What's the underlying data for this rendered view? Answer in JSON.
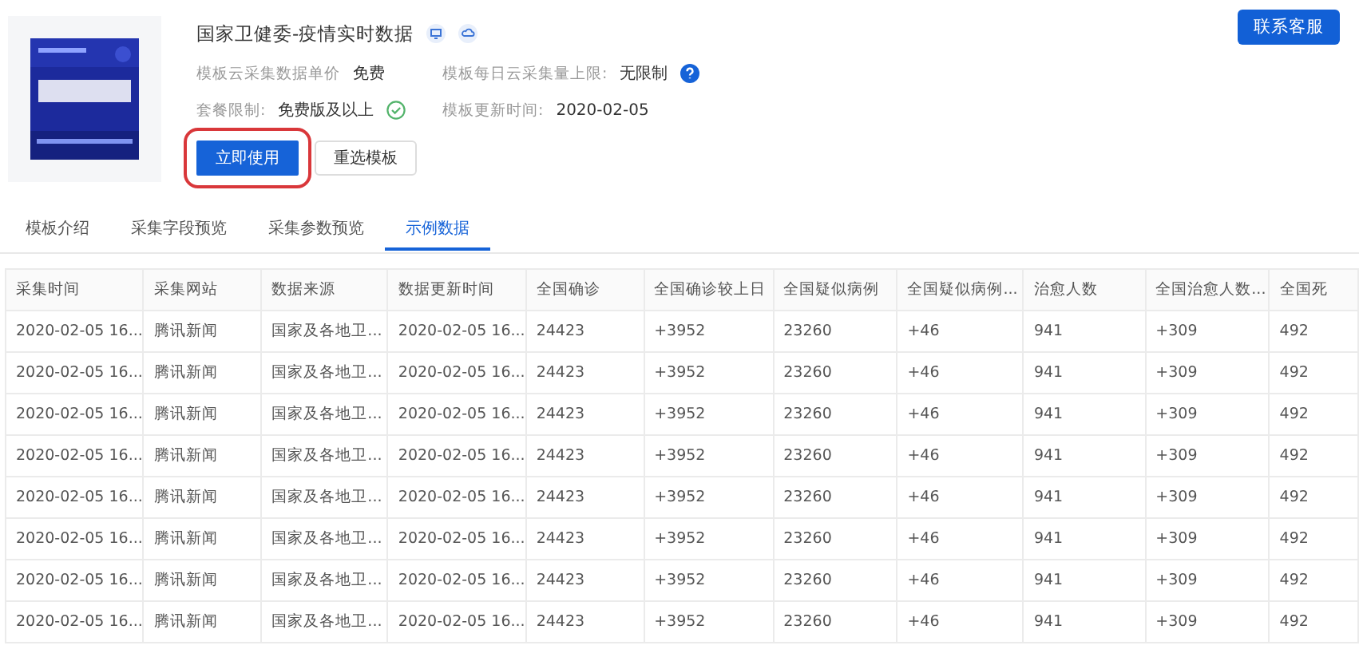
{
  "template": {
    "title": "国家卫健委-疫情实时数据",
    "info": [
      {
        "label": "模板云采集数据单价",
        "value": "免费",
        "kind": "plain"
      },
      {
        "label": "模板每日云采集量上限:",
        "value": "无限制",
        "kind": "help"
      },
      {
        "label": "套餐限制:",
        "value": "免费版及以上",
        "kind": "check"
      },
      {
        "label": "模板更新时间:",
        "value": "2020-02-05",
        "kind": "plain"
      }
    ],
    "buttons": [
      {
        "label": "立即使用",
        "primary": true,
        "highlighted": true
      },
      {
        "label": "重选模板",
        "primary": false,
        "highlighted": false
      }
    ]
  },
  "contact_button": "联系客服",
  "tabs": [
    {
      "label": "模板介绍",
      "selected": false
    },
    {
      "label": "采集字段预览",
      "selected": false
    },
    {
      "label": "采集参数预览",
      "selected": false
    },
    {
      "label": "示例数据",
      "selected": true
    }
  ],
  "table": {
    "columns": [
      "采集时间",
      "采集网站",
      "数据来源",
      "数据更新时间",
      "全国确诊",
      "全国确诊较上日",
      "全国疑似病例",
      "全国疑似病例...",
      "治愈人数",
      "全国治愈人数...",
      "全国死"
    ],
    "rows": [
      [
        "2020-02-05 16...",
        "腾讯新闻",
        "国家及各地卫...",
        "2020-02-05 16...",
        "24423",
        "+3952",
        "23260",
        "+46",
        "941",
        "+309",
        "492"
      ],
      [
        "2020-02-05 16...",
        "腾讯新闻",
        "国家及各地卫...",
        "2020-02-05 16...",
        "24423",
        "+3952",
        "23260",
        "+46",
        "941",
        "+309",
        "492"
      ],
      [
        "2020-02-05 16...",
        "腾讯新闻",
        "国家及各地卫...",
        "2020-02-05 16...",
        "24423",
        "+3952",
        "23260",
        "+46",
        "941",
        "+309",
        "492"
      ],
      [
        "2020-02-05 16...",
        "腾讯新闻",
        "国家及各地卫...",
        "2020-02-05 16...",
        "24423",
        "+3952",
        "23260",
        "+46",
        "941",
        "+309",
        "492"
      ],
      [
        "2020-02-05 16...",
        "腾讯新闻",
        "国家及各地卫...",
        "2020-02-05 16...",
        "24423",
        "+3952",
        "23260",
        "+46",
        "941",
        "+309",
        "492"
      ],
      [
        "2020-02-05 16...",
        "腾讯新闻",
        "国家及各地卫...",
        "2020-02-05 16...",
        "24423",
        "+3952",
        "23260",
        "+46",
        "941",
        "+309",
        "492"
      ],
      [
        "2020-02-05 16...",
        "腾讯新闻",
        "国家及各地卫...",
        "2020-02-05 16...",
        "24423",
        "+3952",
        "23260",
        "+46",
        "941",
        "+309",
        "492"
      ],
      [
        "2020-02-05 16...",
        "腾讯新闻",
        "国家及各地卫...",
        "2020-02-05 16...",
        "24423",
        "+3952",
        "23260",
        "+46",
        "941",
        "+309",
        "492"
      ]
    ]
  }
}
